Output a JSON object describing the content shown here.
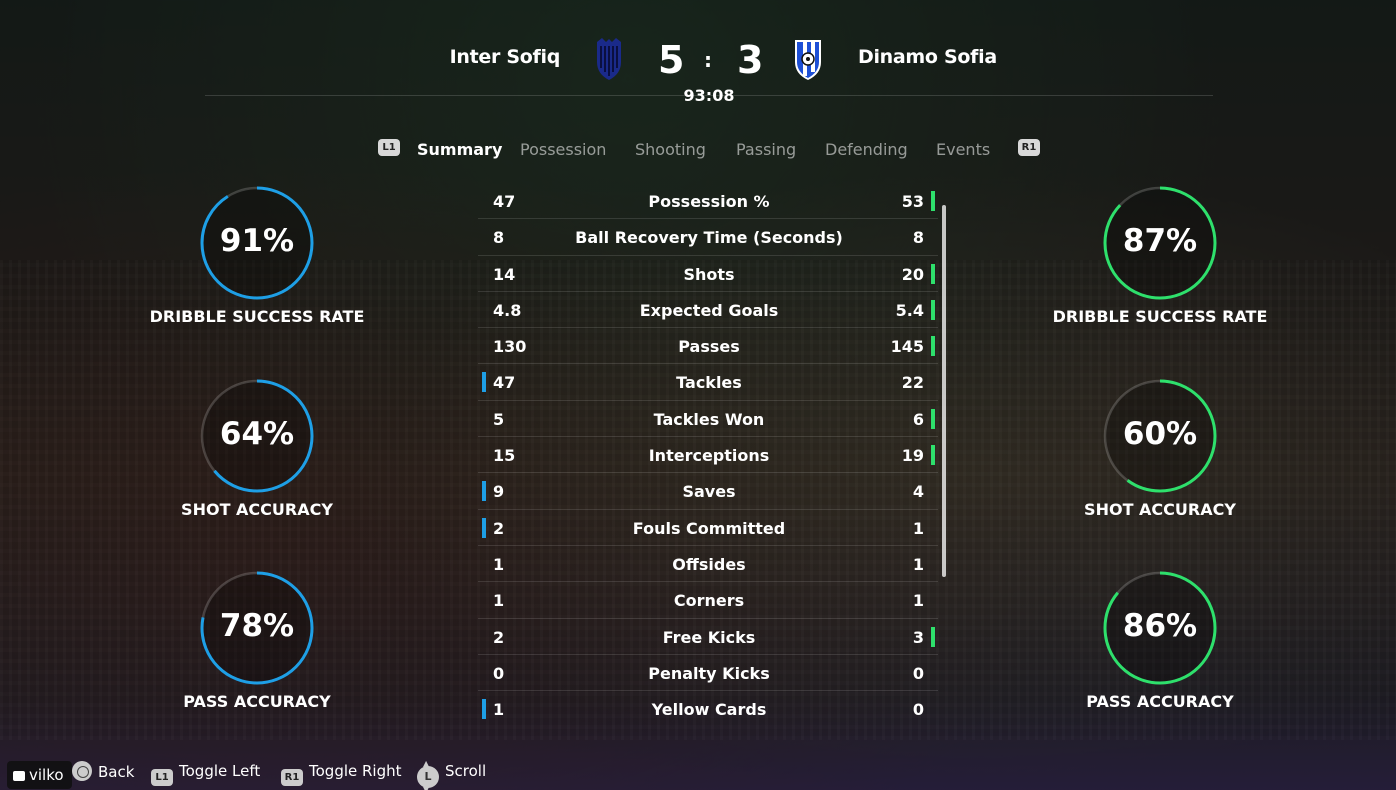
{
  "match": {
    "home_team": "Inter Sofiq",
    "away_team": "Dinamo Sofia",
    "home_score": "5",
    "away_score": "3",
    "separator": ":",
    "clock": "93:08",
    "home_color": "#1e9fe6",
    "away_color": "#2ee06c"
  },
  "tabs": {
    "left_button": "L1",
    "right_button": "R1",
    "items": [
      "Summary",
      "Possession",
      "Shooting",
      "Passing",
      "Defending",
      "Events"
    ],
    "active": "Summary"
  },
  "stats": [
    {
      "label": "Possession %",
      "home": "47",
      "away": "53",
      "leader": "away"
    },
    {
      "label": "Ball Recovery Time (Seconds)",
      "home": "8",
      "away": "8",
      "leader": "none"
    },
    {
      "label": "Shots",
      "home": "14",
      "away": "20",
      "leader": "away"
    },
    {
      "label": "Expected Goals",
      "home": "4.8",
      "away": "5.4",
      "leader": "away"
    },
    {
      "label": "Passes",
      "home": "130",
      "away": "145",
      "leader": "away"
    },
    {
      "label": "Tackles",
      "home": "47",
      "away": "22",
      "leader": "home"
    },
    {
      "label": "Tackles Won",
      "home": "5",
      "away": "6",
      "leader": "away"
    },
    {
      "label": "Interceptions",
      "home": "15",
      "away": "19",
      "leader": "away"
    },
    {
      "label": "Saves",
      "home": "9",
      "away": "4",
      "leader": "home"
    },
    {
      "label": "Fouls Committed",
      "home": "2",
      "away": "1",
      "leader": "home"
    },
    {
      "label": "Offsides",
      "home": "1",
      "away": "1",
      "leader": "none"
    },
    {
      "label": "Corners",
      "home": "1",
      "away": "1",
      "leader": "none"
    },
    {
      "label": "Free Kicks",
      "home": "2",
      "away": "3",
      "leader": "away"
    },
    {
      "label": "Penalty Kicks",
      "home": "0",
      "away": "0",
      "leader": "none"
    },
    {
      "label": "Yellow Cards",
      "home": "1",
      "away": "0",
      "leader": "home"
    }
  ],
  "gauges": {
    "home": [
      {
        "value": "91%",
        "fraction": 0.91,
        "label": "DRIBBLE SUCCESS RATE"
      },
      {
        "value": "64%",
        "fraction": 0.64,
        "label": "SHOT ACCURACY"
      },
      {
        "value": "78%",
        "fraction": 0.78,
        "label": "PASS ACCURACY"
      }
    ],
    "away": [
      {
        "value": "87%",
        "fraction": 0.87,
        "label": "DRIBBLE SUCCESS RATE"
      },
      {
        "value": "60%",
        "fraction": 0.6,
        "label": "SHOT ACCURACY"
      },
      {
        "value": "86%",
        "fraction": 0.86,
        "label": "PASS ACCURACY"
      }
    ]
  },
  "footer": {
    "user": "vilko",
    "back": "Back",
    "toggle_left": "Toggle Left",
    "toggle_right": "Toggle Right",
    "scroll": "Scroll",
    "l1_button": "L1",
    "r1_button": "R1",
    "stick_button": "L"
  }
}
